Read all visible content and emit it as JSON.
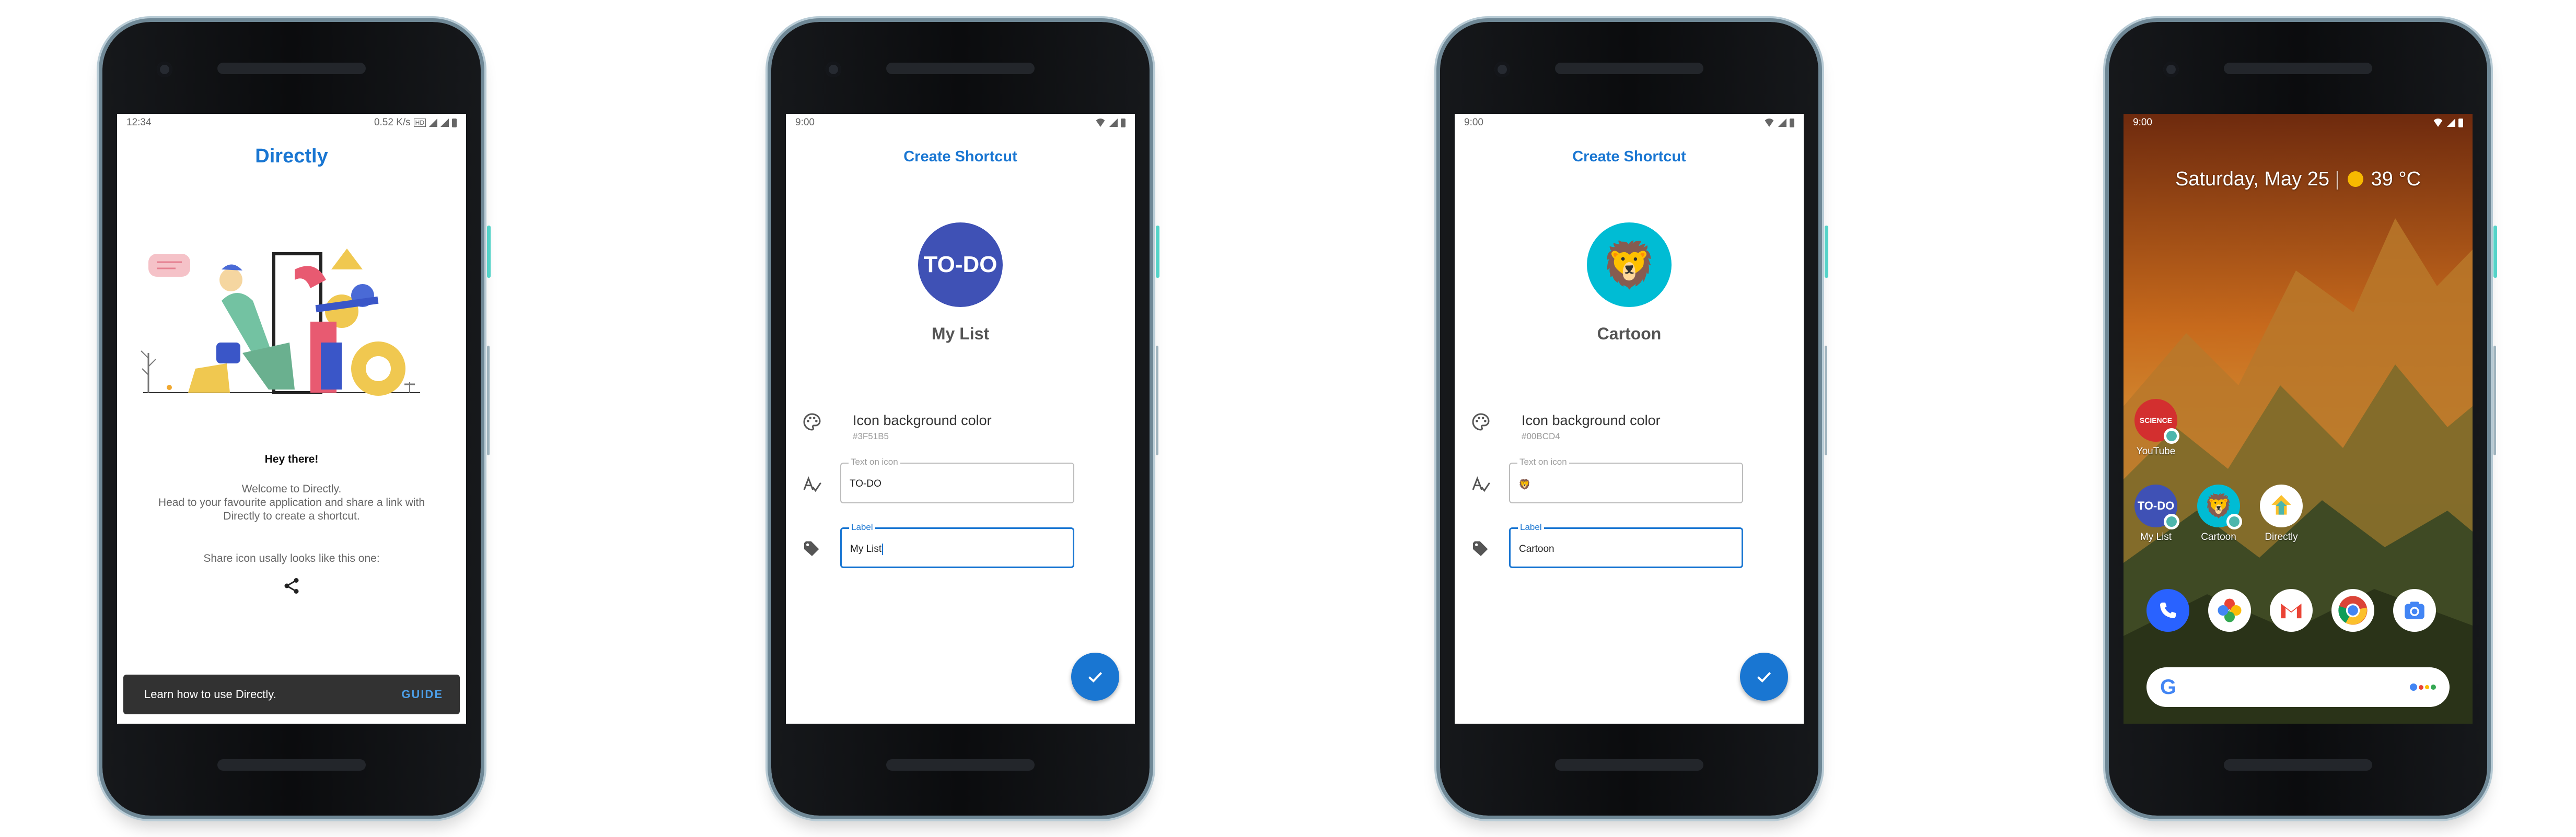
{
  "colors": {
    "accent": "#1976D2",
    "todo_icon_bg": "#3F51B5",
    "cartoon_icon_bg": "#00BCD4",
    "snackbar_bg": "#323232"
  },
  "screen1": {
    "status_time": "12:34",
    "status_speed": "0.52 K/s",
    "status_hd": "HD",
    "app_title": "Directly",
    "greeting": "Hey there!",
    "welcome_text": "Welcome to Directly.\nHead to your favourite application and share a link with Directly to create a shortcut.",
    "share_hint": "Share icon usally looks like this one:",
    "share_icon": "share-icon",
    "snackbar_text": "Learn how to use Directly.",
    "snackbar_action": "GUIDE"
  },
  "screen2": {
    "status_time": "9:00",
    "title": "Create Shortcut",
    "icon_text": "TO-DO",
    "shortcut_name": "My List",
    "color_title": "Icon background color",
    "color_hex": "#3F51B5",
    "text_on_icon_label": "Text on icon",
    "text_on_icon_value": "TO-DO",
    "label_label": "Label",
    "label_value": "My List"
  },
  "screen3": {
    "status_time": "9:00",
    "title": "Create Shortcut",
    "icon_emoji": "🦁",
    "shortcut_name": "Cartoon",
    "color_title": "Icon background color",
    "color_hex": "#00BCD4",
    "text_on_icon_label": "Text on icon",
    "text_on_icon_value": "🦁",
    "label_label": "Label",
    "label_value": "Cartoon"
  },
  "screen4": {
    "status_time": "9:00",
    "date_weather": "Saturday, May 25",
    "temperature": "39 °C",
    "apps": [
      {
        "label": "YouTube",
        "icon_text": "SCIENCE"
      },
      {
        "label": "My List",
        "icon_text": "TO-DO"
      },
      {
        "label": "Cartoon",
        "icon_text": "🦁"
      },
      {
        "label": "Directly",
        "icon_text": ""
      }
    ],
    "dock": [
      "phone-icon",
      "photos-icon",
      "gmail-icon",
      "chrome-icon",
      "camera-icon"
    ],
    "search_logo": "G"
  }
}
